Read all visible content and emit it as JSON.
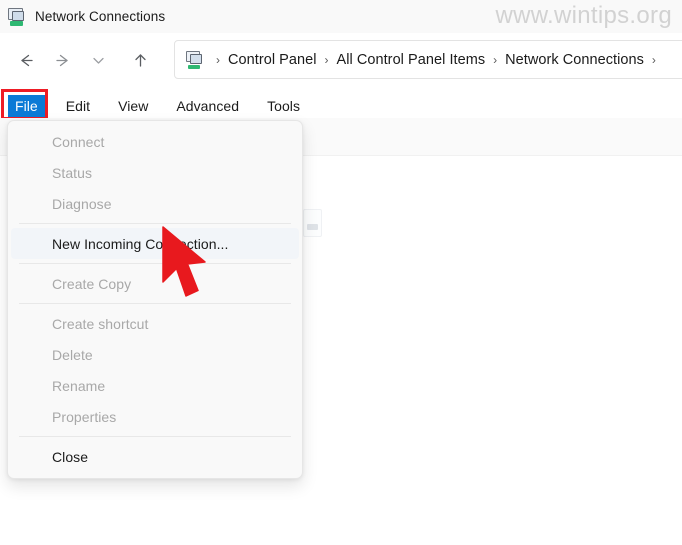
{
  "window": {
    "title": "Network Connections",
    "title_icon": "network-connections-icon"
  },
  "watermark": {
    "text": "www.wintips.org",
    "color": "#d2d2d2"
  },
  "navigation": {
    "back": "back-arrow-icon",
    "forward": "forward-arrow-icon",
    "recent": "chevron-down-icon",
    "up": "up-arrow-icon"
  },
  "breadcrumb": {
    "icon": "network-connections-icon",
    "separator": "›",
    "items": [
      {
        "label": "Control Panel"
      },
      {
        "label": "All Control Panel Items"
      },
      {
        "label": "Network Connections"
      }
    ],
    "trailing_separator": "›"
  },
  "menubar": {
    "items": [
      {
        "label": "File",
        "active": true
      },
      {
        "label": "Edit",
        "active": false
      },
      {
        "label": "View",
        "active": false
      },
      {
        "label": "Advanced",
        "active": false
      },
      {
        "label": "Tools",
        "active": false
      }
    ],
    "active_color": "#0b7ad6",
    "annotation_color": "#ee1c25"
  },
  "file_menu": {
    "items": [
      {
        "label": "Connect",
        "enabled": false,
        "highlighted": false
      },
      {
        "label": "Status",
        "enabled": false,
        "highlighted": false
      },
      {
        "label": "Diagnose",
        "enabled": false,
        "highlighted": false
      },
      {
        "separator": true
      },
      {
        "label": "New Incoming Connection...",
        "enabled": true,
        "highlighted": true
      },
      {
        "separator": true
      },
      {
        "label": "Create Copy",
        "enabled": false,
        "highlighted": false
      },
      {
        "separator": true
      },
      {
        "label": "Create shortcut",
        "enabled": false,
        "highlighted": false
      },
      {
        "label": "Delete",
        "enabled": false,
        "highlighted": false
      },
      {
        "label": "Rename",
        "enabled": false,
        "highlighted": false
      },
      {
        "label": "Properties",
        "enabled": false,
        "highlighted": false
      },
      {
        "separator": true
      },
      {
        "label": "Close",
        "enabled": true,
        "highlighted": false
      }
    ]
  },
  "annotation": {
    "cursor": "red-arrow-cursor",
    "color": "#e8191e"
  }
}
